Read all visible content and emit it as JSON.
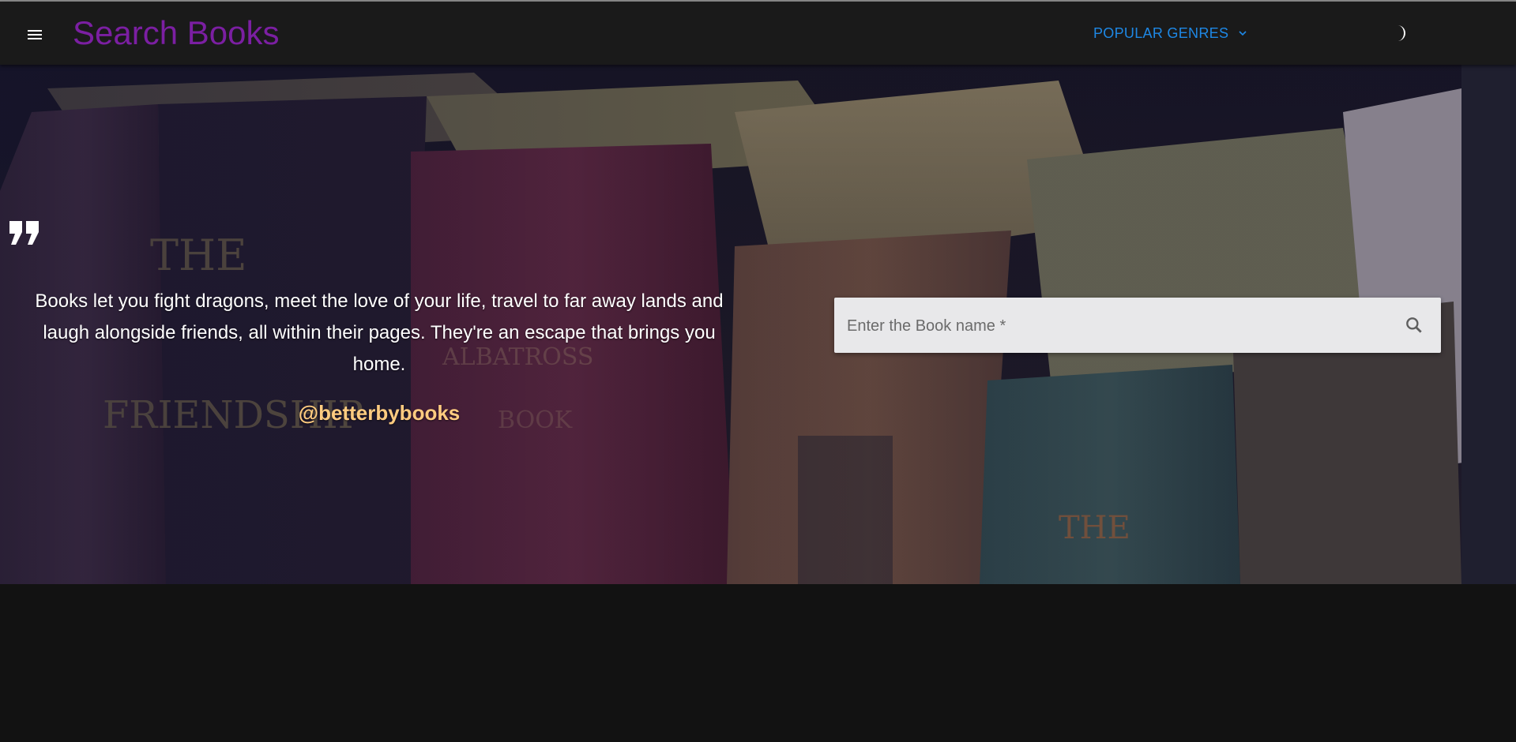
{
  "header": {
    "title": "Search Books",
    "genres_label": "POPULAR GENRES",
    "menu_icon": "hamburger-menu-icon",
    "genres_icon": "chevron-down-icon",
    "theme_icon": "half-moon-icon"
  },
  "hero": {
    "quote": "Books let you fight dragons, meet the love of your life, travel to far away lands and laugh alongside friends, all within their pages. They're an escape that brings you home.",
    "author": "@betterbybooks",
    "quote_icon": "quote-icon"
  },
  "search": {
    "placeholder": "Enter the Book name *",
    "value": "",
    "icon": "search-icon"
  },
  "colors": {
    "title": "#7b1fa2",
    "genres": "#1e88e5",
    "author": "#ffcc80",
    "appbar": "#1a1a1a",
    "background": "#121212"
  }
}
